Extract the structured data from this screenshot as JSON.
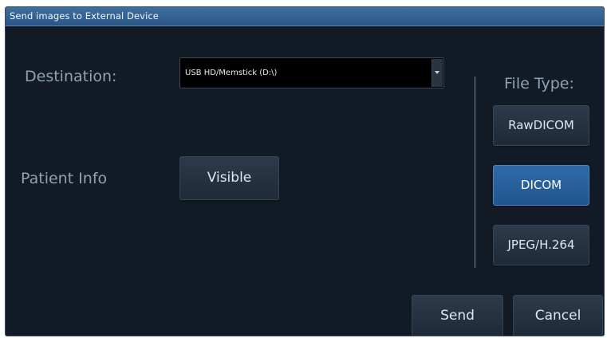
{
  "dialog": {
    "title": "Send images to External Device"
  },
  "destination": {
    "label": "Destination:",
    "selected_value": "USB HD/Memstick (D:\\)"
  },
  "patient_info": {
    "label": "Patient Info",
    "button_label": "Visible"
  },
  "file_type": {
    "label": "File Type:",
    "options": [
      {
        "label": "RawDICOM",
        "selected": false
      },
      {
        "label": "DICOM",
        "selected": true
      },
      {
        "label": "JPEG/H.264",
        "selected": false
      }
    ]
  },
  "actions": {
    "send_label": "Send",
    "cancel_label": "Cancel"
  },
  "colors": {
    "background": "#121b25",
    "titlebar": "#2f5d8f",
    "selected_button": "#2a63a0",
    "label_text": "#8fa2b4"
  }
}
